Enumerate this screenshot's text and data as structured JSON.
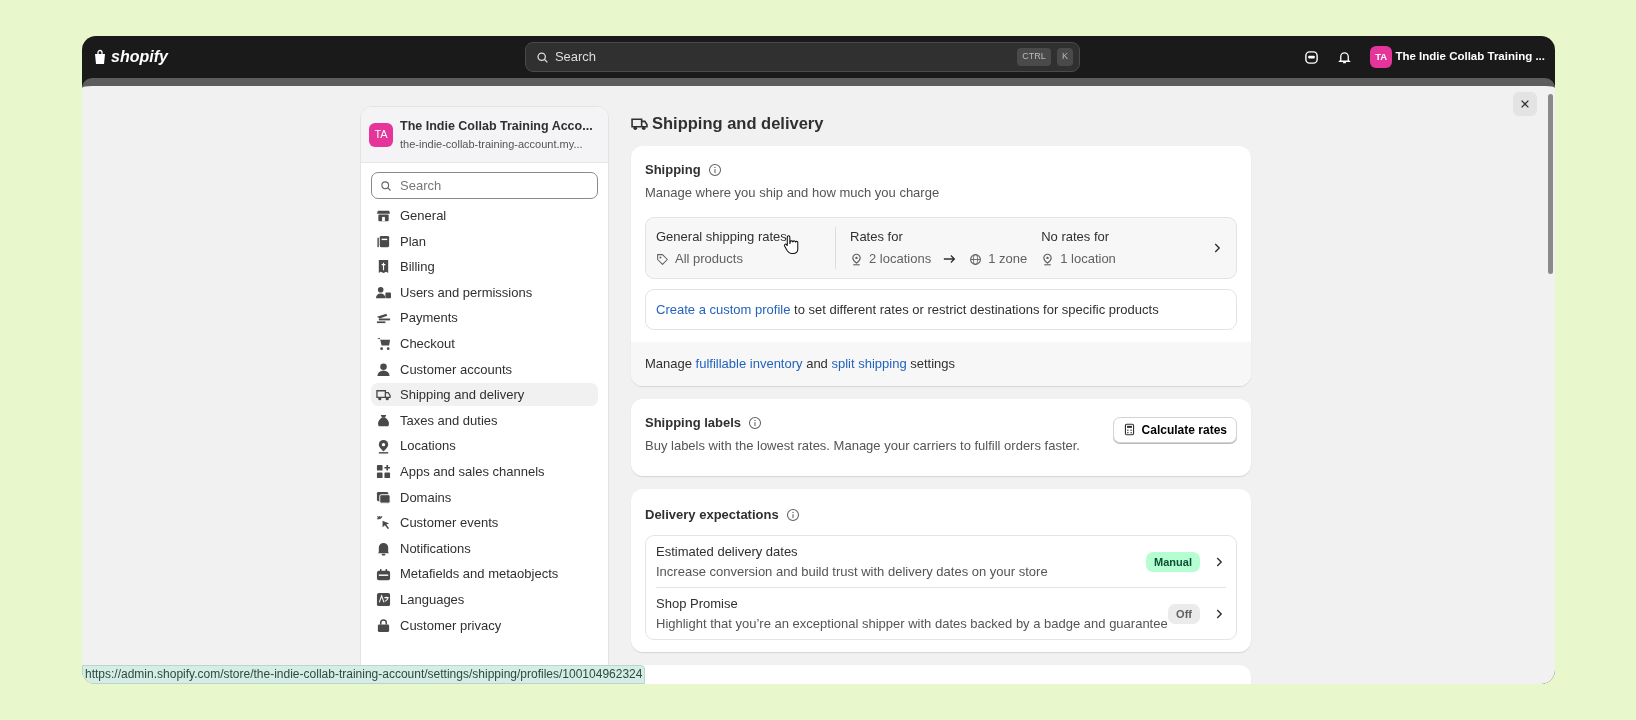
{
  "topbar": {
    "logo": "shopify",
    "search": {
      "placeholder": "Search",
      "shortcut": [
        "CTRL",
        "K"
      ]
    },
    "store": {
      "initials": "TA",
      "name": "The Indie Collab Training ..."
    }
  },
  "sidebar": {
    "store": {
      "initials": "TA",
      "name": "The Indie Collab Training Acco...",
      "domain": "the-indie-collab-training-account.my..."
    },
    "search": {
      "placeholder": "Search"
    },
    "items": [
      {
        "label": "General",
        "selected": false
      },
      {
        "label": "Plan",
        "selected": false
      },
      {
        "label": "Billing",
        "selected": false
      },
      {
        "label": "Users and permissions",
        "selected": false
      },
      {
        "label": "Payments",
        "selected": false
      },
      {
        "label": "Checkout",
        "selected": false
      },
      {
        "label": "Customer accounts",
        "selected": false
      },
      {
        "label": "Shipping and delivery",
        "selected": true
      },
      {
        "label": "Taxes and duties",
        "selected": false
      },
      {
        "label": "Locations",
        "selected": false
      },
      {
        "label": "Apps and sales channels",
        "selected": false
      },
      {
        "label": "Domains",
        "selected": false
      },
      {
        "label": "Customer events",
        "selected": false
      },
      {
        "label": "Notifications",
        "selected": false
      },
      {
        "label": "Metafields and metaobjects",
        "selected": false
      },
      {
        "label": "Languages",
        "selected": false
      },
      {
        "label": "Customer privacy",
        "selected": false
      }
    ]
  },
  "page": {
    "title": "Shipping and delivery"
  },
  "shipping": {
    "title": "Shipping",
    "description": "Manage where you ship and how much you charge",
    "profile": {
      "title": "General shipping rates",
      "products": "All products",
      "rates_label": "Rates for",
      "locations": "2 locations",
      "zones": "1 zone",
      "no_rates_label": "No rates for",
      "no_rates": "1 location"
    },
    "custom_profile": [
      {
        "text": "Create a custom profile",
        "link": true
      },
      {
        "text": " to set different rates or restrict destinations for specific products",
        "link": false
      }
    ],
    "footer": [
      {
        "text": "Manage ",
        "link": false
      },
      {
        "text": "fulfillable inventory",
        "link": true
      },
      {
        "text": " and ",
        "link": false
      },
      {
        "text": "split shipping",
        "link": true
      },
      {
        "text": " settings",
        "link": false
      }
    ]
  },
  "shipping_labels": {
    "title": "Shipping labels",
    "description": "Buy labels with the lowest rates. Manage your carriers to fulfill orders faster.",
    "button": "Calculate rates"
  },
  "delivery_expectations": {
    "title": "Delivery expectations",
    "rows": [
      {
        "title": "Estimated delivery dates",
        "description": "Increase conversion and build trust with delivery dates on your store",
        "status": "Manual",
        "enabled": true
      },
      {
        "title": "Shop Promise",
        "description": "Highlight that you’re an exceptional shipper with dates backed by a badge and guarantee",
        "status": "Off",
        "enabled": false
      }
    ]
  },
  "status_bar": {
    "url": "https://admin.shopify.com/store/the-indie-collab-training-account/settings/shipping/profiles/100104962324"
  }
}
